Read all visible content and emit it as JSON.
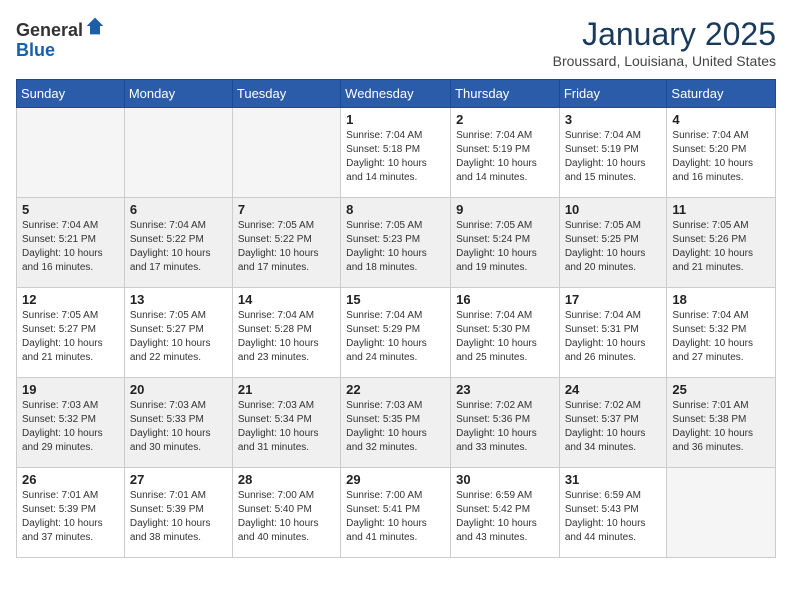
{
  "header": {
    "logo_line1": "General",
    "logo_line2": "Blue",
    "title": "January 2025",
    "subtitle": "Broussard, Louisiana, United States"
  },
  "weekdays": [
    "Sunday",
    "Monday",
    "Tuesday",
    "Wednesday",
    "Thursday",
    "Friday",
    "Saturday"
  ],
  "weeks": [
    [
      {
        "day": "",
        "content": ""
      },
      {
        "day": "",
        "content": ""
      },
      {
        "day": "",
        "content": ""
      },
      {
        "day": "1",
        "content": "Sunrise: 7:04 AM\nSunset: 5:18 PM\nDaylight: 10 hours\nand 14 minutes."
      },
      {
        "day": "2",
        "content": "Sunrise: 7:04 AM\nSunset: 5:19 PM\nDaylight: 10 hours\nand 14 minutes."
      },
      {
        "day": "3",
        "content": "Sunrise: 7:04 AM\nSunset: 5:19 PM\nDaylight: 10 hours\nand 15 minutes."
      },
      {
        "day": "4",
        "content": "Sunrise: 7:04 AM\nSunset: 5:20 PM\nDaylight: 10 hours\nand 16 minutes."
      }
    ],
    [
      {
        "day": "5",
        "content": "Sunrise: 7:04 AM\nSunset: 5:21 PM\nDaylight: 10 hours\nand 16 minutes."
      },
      {
        "day": "6",
        "content": "Sunrise: 7:04 AM\nSunset: 5:22 PM\nDaylight: 10 hours\nand 17 minutes."
      },
      {
        "day": "7",
        "content": "Sunrise: 7:05 AM\nSunset: 5:22 PM\nDaylight: 10 hours\nand 17 minutes."
      },
      {
        "day": "8",
        "content": "Sunrise: 7:05 AM\nSunset: 5:23 PM\nDaylight: 10 hours\nand 18 minutes."
      },
      {
        "day": "9",
        "content": "Sunrise: 7:05 AM\nSunset: 5:24 PM\nDaylight: 10 hours\nand 19 minutes."
      },
      {
        "day": "10",
        "content": "Sunrise: 7:05 AM\nSunset: 5:25 PM\nDaylight: 10 hours\nand 20 minutes."
      },
      {
        "day": "11",
        "content": "Sunrise: 7:05 AM\nSunset: 5:26 PM\nDaylight: 10 hours\nand 21 minutes."
      }
    ],
    [
      {
        "day": "12",
        "content": "Sunrise: 7:05 AM\nSunset: 5:27 PM\nDaylight: 10 hours\nand 21 minutes."
      },
      {
        "day": "13",
        "content": "Sunrise: 7:05 AM\nSunset: 5:27 PM\nDaylight: 10 hours\nand 22 minutes."
      },
      {
        "day": "14",
        "content": "Sunrise: 7:04 AM\nSunset: 5:28 PM\nDaylight: 10 hours\nand 23 minutes."
      },
      {
        "day": "15",
        "content": "Sunrise: 7:04 AM\nSunset: 5:29 PM\nDaylight: 10 hours\nand 24 minutes."
      },
      {
        "day": "16",
        "content": "Sunrise: 7:04 AM\nSunset: 5:30 PM\nDaylight: 10 hours\nand 25 minutes."
      },
      {
        "day": "17",
        "content": "Sunrise: 7:04 AM\nSunset: 5:31 PM\nDaylight: 10 hours\nand 26 minutes."
      },
      {
        "day": "18",
        "content": "Sunrise: 7:04 AM\nSunset: 5:32 PM\nDaylight: 10 hours\nand 27 minutes."
      }
    ],
    [
      {
        "day": "19",
        "content": "Sunrise: 7:03 AM\nSunset: 5:32 PM\nDaylight: 10 hours\nand 29 minutes."
      },
      {
        "day": "20",
        "content": "Sunrise: 7:03 AM\nSunset: 5:33 PM\nDaylight: 10 hours\nand 30 minutes."
      },
      {
        "day": "21",
        "content": "Sunrise: 7:03 AM\nSunset: 5:34 PM\nDaylight: 10 hours\nand 31 minutes."
      },
      {
        "day": "22",
        "content": "Sunrise: 7:03 AM\nSunset: 5:35 PM\nDaylight: 10 hours\nand 32 minutes."
      },
      {
        "day": "23",
        "content": "Sunrise: 7:02 AM\nSunset: 5:36 PM\nDaylight: 10 hours\nand 33 minutes."
      },
      {
        "day": "24",
        "content": "Sunrise: 7:02 AM\nSunset: 5:37 PM\nDaylight: 10 hours\nand 34 minutes."
      },
      {
        "day": "25",
        "content": "Sunrise: 7:01 AM\nSunset: 5:38 PM\nDaylight: 10 hours\nand 36 minutes."
      }
    ],
    [
      {
        "day": "26",
        "content": "Sunrise: 7:01 AM\nSunset: 5:39 PM\nDaylight: 10 hours\nand 37 minutes."
      },
      {
        "day": "27",
        "content": "Sunrise: 7:01 AM\nSunset: 5:39 PM\nDaylight: 10 hours\nand 38 minutes."
      },
      {
        "day": "28",
        "content": "Sunrise: 7:00 AM\nSunset: 5:40 PM\nDaylight: 10 hours\nand 40 minutes."
      },
      {
        "day": "29",
        "content": "Sunrise: 7:00 AM\nSunset: 5:41 PM\nDaylight: 10 hours\nand 41 minutes."
      },
      {
        "day": "30",
        "content": "Sunrise: 6:59 AM\nSunset: 5:42 PM\nDaylight: 10 hours\nand 43 minutes."
      },
      {
        "day": "31",
        "content": "Sunrise: 6:59 AM\nSunset: 5:43 PM\nDaylight: 10 hours\nand 44 minutes."
      },
      {
        "day": "",
        "content": ""
      }
    ]
  ]
}
